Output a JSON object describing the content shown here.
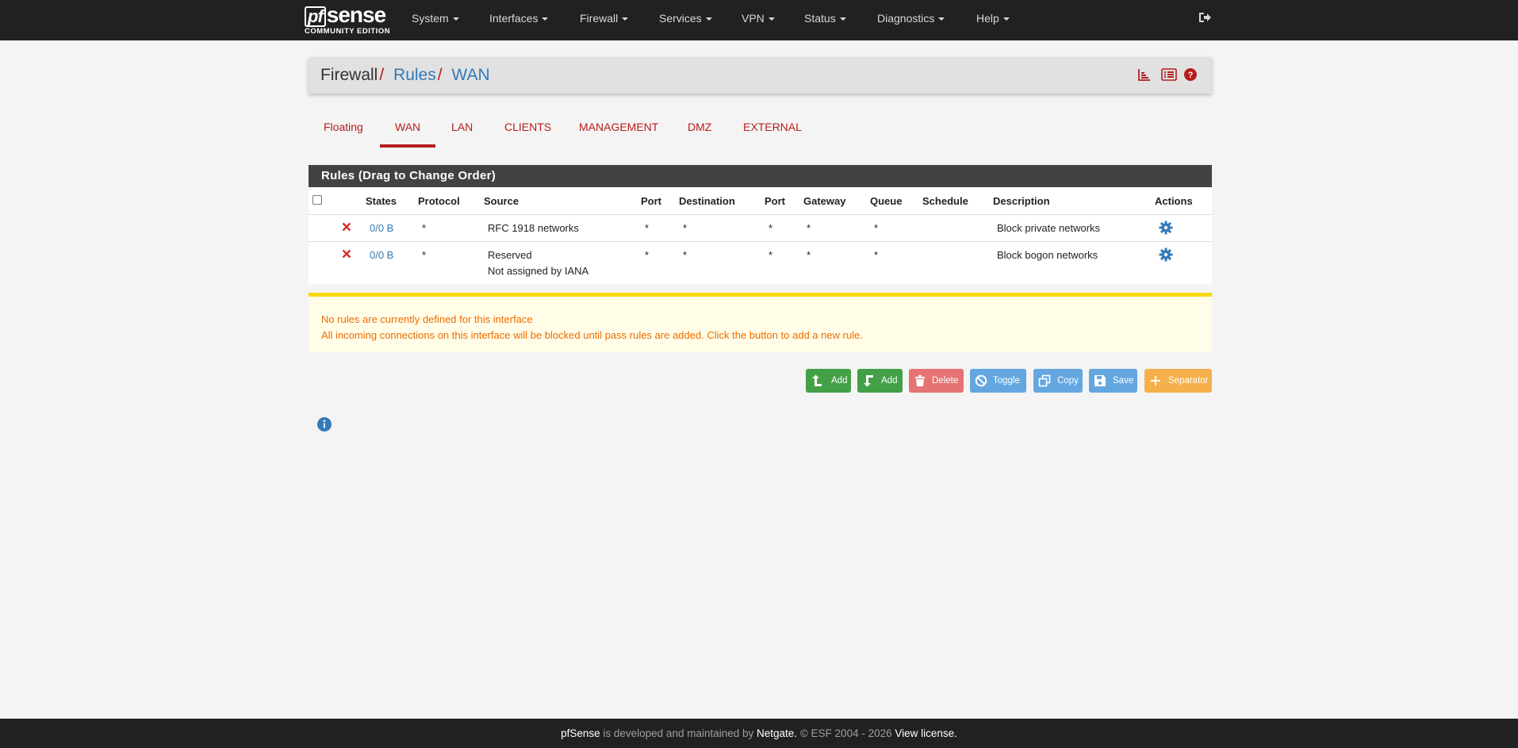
{
  "brand": {
    "word_pf": "pf",
    "word_sense": "sense",
    "edition": "COMMUNITY EDITION"
  },
  "nav": [
    "System",
    "Interfaces",
    "Firewall",
    "Services",
    "VPN",
    "Status",
    "Diagnostics",
    "Help"
  ],
  "breadcrumb": {
    "root": "Firewall",
    "level1": "Rules",
    "level2": "WAN",
    "separator": "/"
  },
  "tabs": [
    "Floating",
    "WAN",
    "LAN",
    "CLIENTS",
    "MANAGEMENT",
    "DMZ",
    "EXTERNAL"
  ],
  "active_tab": "WAN",
  "table": {
    "title": "Rules (Drag to Change Order)",
    "headers": [
      "States",
      "Protocol",
      "Source",
      "Port",
      "Destination",
      "Port",
      "Gateway",
      "Queue",
      "Schedule",
      "Description",
      "Actions"
    ],
    "rows": [
      {
        "states": "0/0 B",
        "protocol": "*",
        "source": "RFC 1918 networks",
        "source2": "",
        "src_port": "*",
        "destination": "*",
        "dst_port": "*",
        "gateway": "*",
        "queue": "*",
        "schedule": "",
        "description": "Block private networks"
      },
      {
        "states": "0/0 B",
        "protocol": "*",
        "source": "Reserved",
        "source2": "Not assigned by IANA",
        "src_port": "*",
        "destination": "*",
        "dst_port": "*",
        "gateway": "*",
        "queue": "*",
        "schedule": "",
        "description": "Block bogon networks"
      }
    ]
  },
  "warning": {
    "line1": "No rules are currently defined for this interface",
    "line2": "All incoming connections on this interface will be blocked until pass rules are added. Click the button to add a new rule."
  },
  "buttons": {
    "add_top": "Add",
    "add_bottom": "Add",
    "delete": "Delete",
    "toggle": "Toggle",
    "copy": "Copy",
    "save": "Save",
    "separator": "Separator"
  },
  "footer": {
    "brand": "pfSense",
    "text1": "is developed and maintained by",
    "company": "Netgate.",
    "text2": "© ESF 2004 - 2026",
    "license": "View license."
  },
  "colors": {
    "navbar": "#212121",
    "accent_red": "#b71c1c",
    "link_blue": "#337ab7",
    "success_green": "#43a047",
    "danger": "#e57373",
    "info_blue": "#64a7e0",
    "warning_orange": "#f6b04b"
  },
  "icons": [
    "logout-icon",
    "chart-icon",
    "list-icon",
    "help-icon",
    "block-x-icon",
    "gear-icon",
    "arrow-up-icon",
    "arrow-down-icon",
    "trash-icon",
    "ban-icon",
    "copy-icon",
    "save-icon",
    "plus-icon",
    "info-icon"
  ]
}
